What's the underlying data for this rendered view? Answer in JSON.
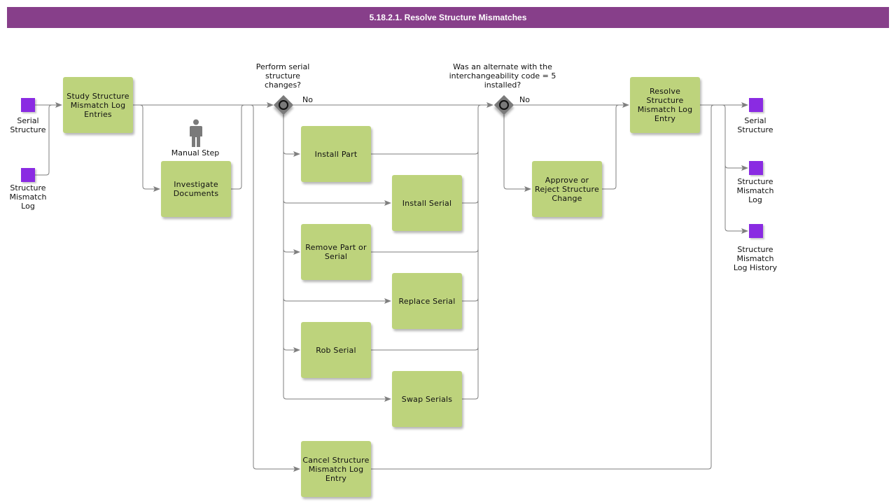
{
  "header": {
    "title": "5.18.2.1. Resolve Structure Mismatches",
    "color": "#873f8a"
  },
  "colors": {
    "task": "#bdd37c",
    "data_object": "#8a2be2",
    "gateway": "#7a7a7a",
    "connector": "#7f7f7f"
  },
  "inputs": [
    {
      "label": "Serial\nStructure"
    },
    {
      "label": "Structure\nMismatch\nLog"
    }
  ],
  "outputs": [
    {
      "label": "Serial\nStructure"
    },
    {
      "label": "Structure\nMismatch\nLog"
    },
    {
      "label": "Structure\nMismatch\nLog History"
    }
  ],
  "tasks": {
    "study": "Study Structure Mismatch Log Entries",
    "investigate": "Investigate Documents",
    "install_part": "Install Part",
    "install_serial": "Install Serial",
    "remove_part": "Remove Part or Serial",
    "replace_serial": "Replace Serial",
    "rob_serial": "Rob Serial",
    "swap_serials": "Swap Serials",
    "cancel": "Cancel Structure Mismatch Log Entry",
    "approve": "Approve or Reject Structure Change",
    "resolve": "Resolve Structure Mismatch Log Entry"
  },
  "manual_step": {
    "label": "Manual Step",
    "icon": "person-icon"
  },
  "gateways": [
    {
      "question": "Perform serial\nstructure\nchanges?",
      "no_label": "No"
    },
    {
      "question": "Was an alternate with the\ninterchangeability code = 5\ninstalled?",
      "no_label": "No"
    }
  ]
}
